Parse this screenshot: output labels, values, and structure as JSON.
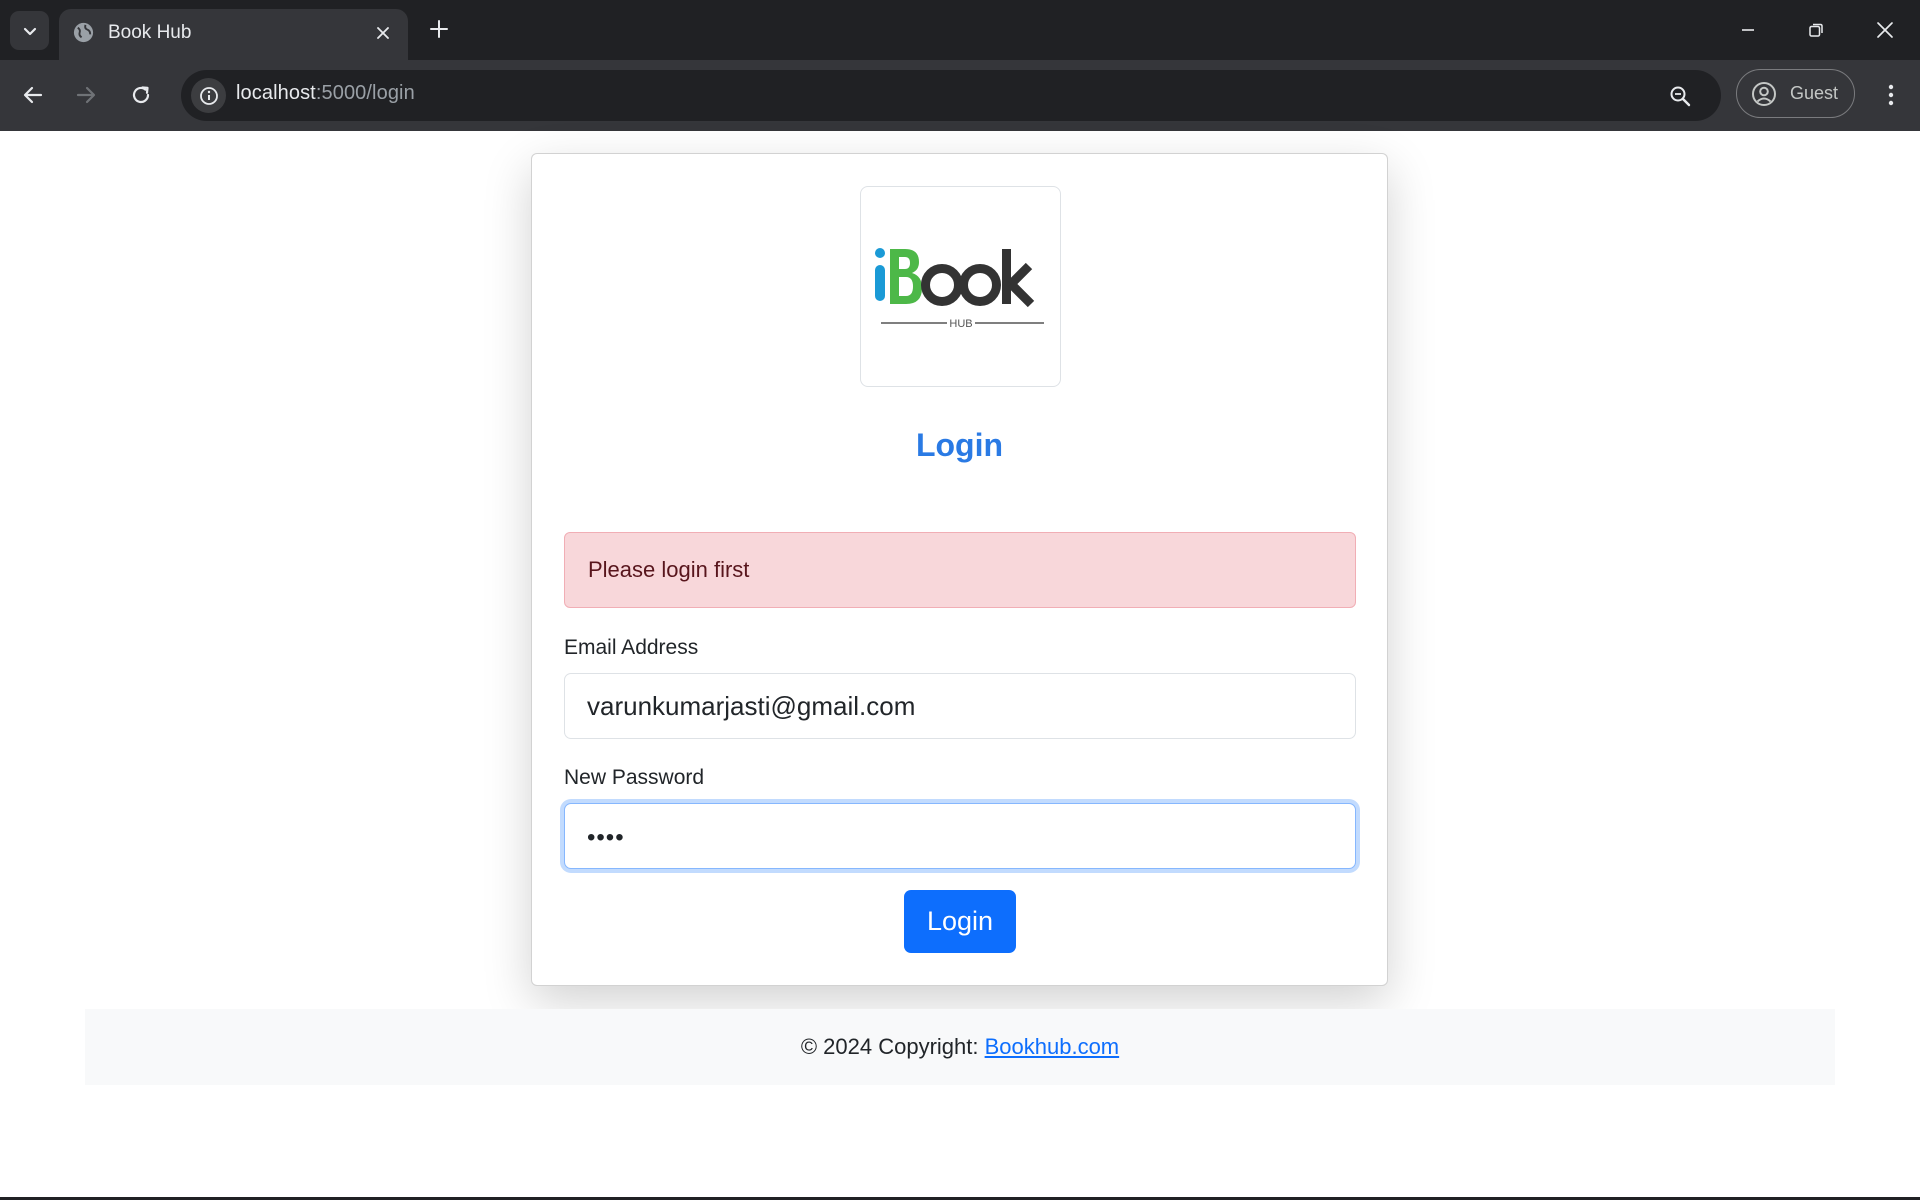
{
  "browser": {
    "tab_title": "Book Hub",
    "url_host": "localhost",
    "url_path": ":5000/login",
    "profile_label": "Guest"
  },
  "page": {
    "logo": {
      "wordmark": "Book",
      "sub": "HUB"
    },
    "title": "Login",
    "alert": "Please login first",
    "email": {
      "label": "Email Address",
      "value": "varunkumarjasti@gmail.com"
    },
    "password": {
      "label": "New Password",
      "value": "••••"
    },
    "submit_label": "Login"
  },
  "footer": {
    "copyright": "© 2024 Copyright: ",
    "link_text": "Bookhub.com"
  },
  "colors": {
    "brand_blue": "#0d6efd",
    "alert_bg": "#f8d7da",
    "logo_green": "#4db848",
    "logo_blue": "#1a9ad6"
  }
}
